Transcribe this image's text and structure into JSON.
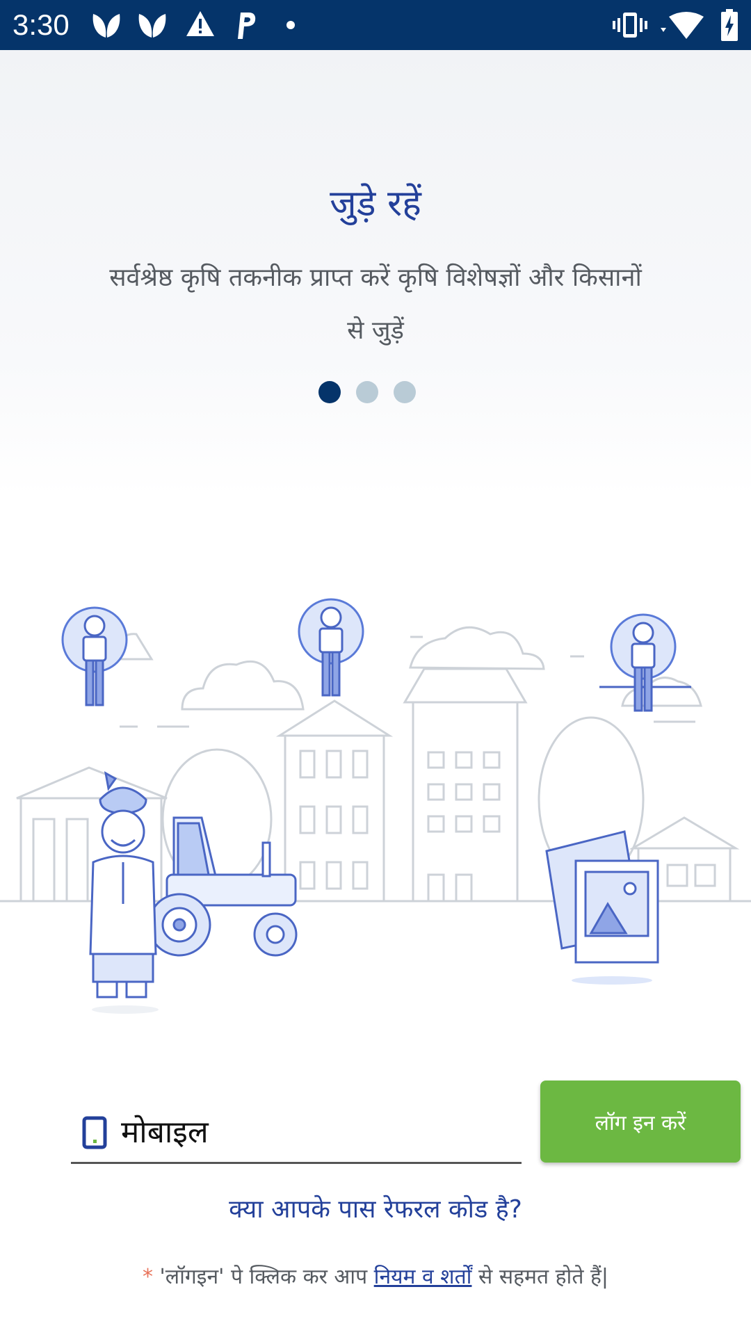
{
  "status_bar": {
    "time": "3:30",
    "left_icons": [
      "leaf-notification-icon",
      "leaf-notification-icon",
      "warning-icon",
      "parking-p-icon",
      "dot-icon"
    ],
    "right_icons": [
      "vibrate-icon",
      "wifi-icon",
      "battery-charging-icon"
    ],
    "background": "#05346a"
  },
  "onboarding": {
    "title": "जुड़े रहें",
    "subtitle": "सर्वश्रेष्ठ कृषि तकनीक प्राप्त करें कृषि विशेषज्ञों और किसानों से जुड़ें",
    "pagination": {
      "total": 3,
      "active": 1
    }
  },
  "illustration": {
    "icons": [
      "farmer-illustration-icon",
      "tractor-icon",
      "user-avatar-icon",
      "photo-gallery-icon",
      "city-buildings-icon",
      "cloud-icon"
    ]
  },
  "login": {
    "mobile_placeholder": "मोबाइल",
    "mobile_icon": "smartphone-icon",
    "button_label": "लॉग इन करें",
    "button_color": "#6cb842",
    "referral_link": "क्या आपके पास रेफरल कोड है?",
    "terms_asterisk": "*",
    "terms_prefix": "'लॉगइन' पे क्लिक कर आप",
    "terms_link": "नियम व शर्तों",
    "terms_suffix": "से सहमत होते हैं|"
  },
  "colors": {
    "accent_blue": "#23409a",
    "dot_active": "#05346a",
    "dot_inactive": "#b9cbd6"
  }
}
